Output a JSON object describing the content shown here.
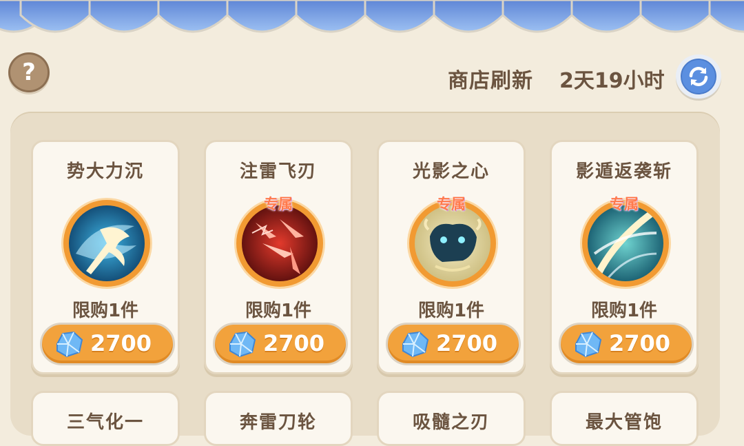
{
  "shop": {
    "refresh_label": "商店刷新",
    "refresh_time": "2天19小时",
    "help_glyph": "?"
  },
  "colors": {
    "background": "#f3ecdd",
    "awning_blue": "#7fa6e6",
    "price_orange": "#f2a23c",
    "text_brown": "#6b5440"
  },
  "items": [
    {
      "name": "势大力沉",
      "exclusive": "",
      "limit": "限购1件",
      "price": "2700",
      "icon": "axe-wave-skill-icon"
    },
    {
      "name": "注雷飞刃",
      "exclusive": "专属",
      "limit": "限购1件",
      "price": "2700",
      "icon": "thunder-blades-skill-icon"
    },
    {
      "name": "光影之心",
      "exclusive": "专属",
      "limit": "限购1件",
      "price": "2700",
      "icon": "beast-spirit-skill-icon"
    },
    {
      "name": "影遁返袭斩",
      "exclusive": "专属",
      "limit": "限购1件",
      "price": "2700",
      "icon": "shadow-slash-skill-icon"
    }
  ],
  "next_row": [
    {
      "name": "三气化一"
    },
    {
      "name": "奔雷刀轮"
    },
    {
      "name": "吸髓之刃"
    },
    {
      "name": "最大管饱"
    }
  ],
  "currency_icon": "blue-crystal-icon"
}
